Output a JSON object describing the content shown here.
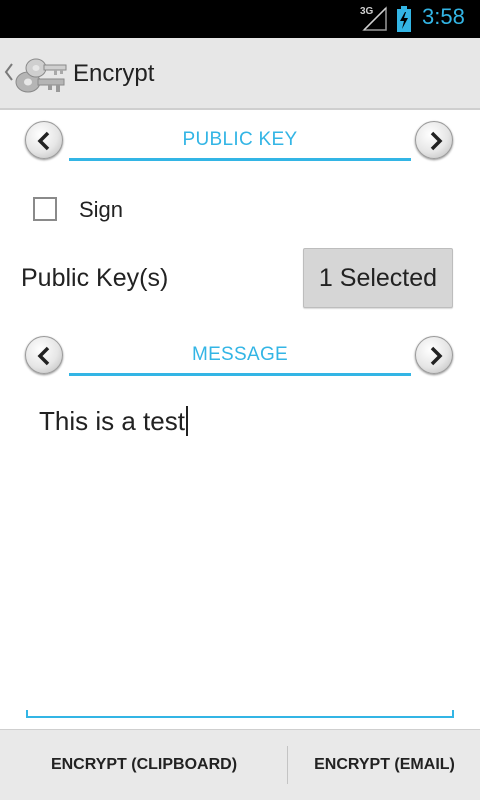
{
  "status_bar": {
    "network": "3G",
    "time": "3:58",
    "accent_color": "#33b5e5"
  },
  "action_bar": {
    "title": "Encrypt",
    "icon": "keys-icon"
  },
  "sections": {
    "public_key": {
      "label": "PUBLIC KEY"
    },
    "message": {
      "label": "MESSAGE"
    }
  },
  "sign": {
    "label": "Sign",
    "checked": false
  },
  "public_keys": {
    "label": "Public Key(s)",
    "button_label": "1 Selected"
  },
  "message": {
    "value": "This is a test"
  },
  "buttons": {
    "encrypt_clipboard": "ENCRYPT (CLIPBOARD)",
    "encrypt_email": "ENCRYPT (EMAIL)"
  }
}
